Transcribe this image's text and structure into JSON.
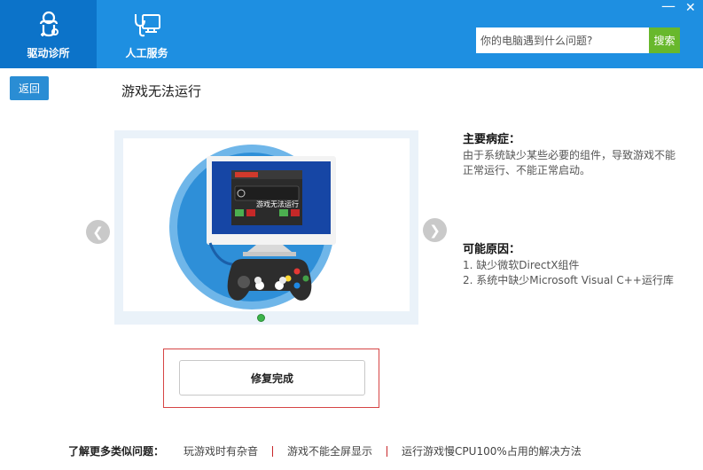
{
  "header": {
    "tabs": [
      {
        "label": "驱动诊所",
        "icon": "doctor-icon",
        "active": true
      },
      {
        "label": "人工服务",
        "icon": "monitor-stethoscope-icon",
        "active": false
      }
    ],
    "search": {
      "placeholder": "你的电脑遇到什么问题?",
      "button_label": "搜索"
    },
    "window": {
      "minimize": "—",
      "close": "✕"
    }
  },
  "page": {
    "back_label": "返回",
    "title": "游戏无法运行"
  },
  "carousel": {
    "screen_text": "游戏无法运行",
    "prev_glyph": "❮",
    "next_glyph": "❯",
    "active_slide": 1
  },
  "symptom": {
    "heading": "主要病症：",
    "text": "由于系统缺少某些必要的组件，导致游戏不能正常运行、不能正常启动。"
  },
  "cause": {
    "heading": "可能原因：",
    "items": [
      "1. 缺少微软DirectX组件",
      "2. 系统中缺少Microsoft Visual C++运行库"
    ]
  },
  "fix_button_label": "修复完成",
  "footer": {
    "label": "了解更多类似问题：",
    "links": [
      "玩游戏时有杂音",
      "游戏不能全屏显示",
      "运行游戏慢CPU100%占用的解决方法"
    ]
  },
  "colors": {
    "header": "#1e8fe1",
    "active_tab": "#0c73c9",
    "search_button": "#68b82c",
    "outline": "#d64545"
  }
}
